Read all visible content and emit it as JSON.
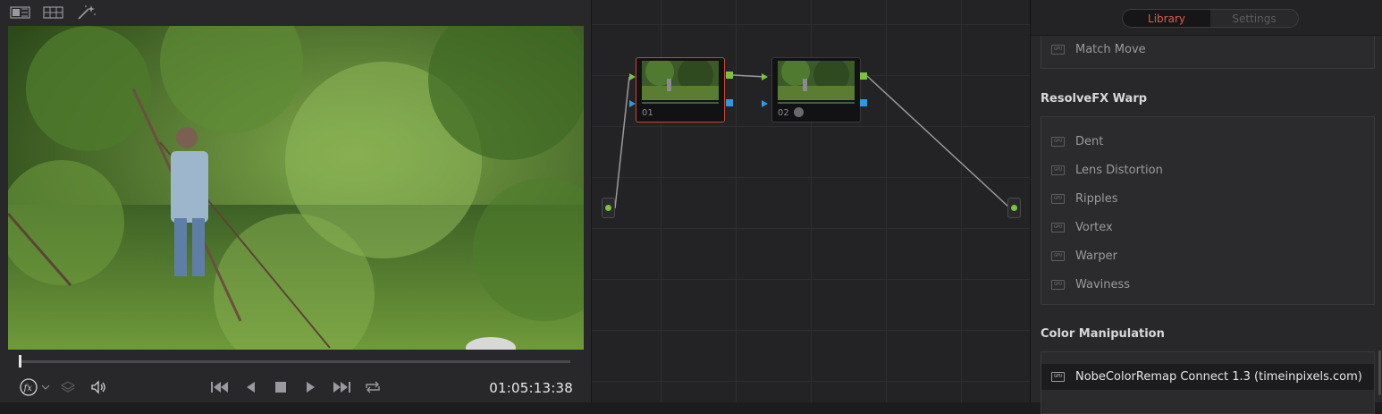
{
  "viewer": {
    "toolbar_icons": [
      "single-viewer-icon",
      "grid-viewer-icon",
      "magic-wand-icon"
    ],
    "timecode": "01:05:13:38",
    "playhead_position": 0.0,
    "transport_icons": [
      "fx-icon",
      "chevron-down-icon",
      "layers-icon",
      "speaker-icon",
      "skip-to-start-icon",
      "play-reverse-icon",
      "stop-icon",
      "play-icon",
      "skip-to-end-icon",
      "loop-icon"
    ]
  },
  "node_graph": {
    "nodes": [
      {
        "label": "01",
        "selected": true
      },
      {
        "label": "02",
        "selected": false
      }
    ]
  },
  "library": {
    "tabs": [
      {
        "label": "Library",
        "active": true
      },
      {
        "label": "Settings",
        "active": false
      }
    ],
    "top_items": [
      {
        "gpu": "GPU",
        "name": "Match Move"
      }
    ],
    "sections": [
      {
        "title": "ResolveFX Warp",
        "items": [
          {
            "gpu": "GPU",
            "name": "Dent"
          },
          {
            "gpu": "GPU",
            "name": "Lens Distortion"
          },
          {
            "gpu": "GPU",
            "name": "Ripples"
          },
          {
            "gpu": "GPU",
            "name": "Vortex"
          },
          {
            "gpu": "GPU",
            "name": "Warper"
          },
          {
            "gpu": "GPU",
            "name": "Waviness"
          }
        ]
      },
      {
        "title": "Color Manipulation",
        "items": [
          {
            "gpu": "GPU",
            "name": "NobeColorRemap Connect 1.3 (timeinpixels.com)"
          }
        ]
      }
    ]
  },
  "colors": {
    "accent_red": "#e05a4a",
    "node_selected_border": "#c6443a",
    "port_green": "#7cc23b",
    "port_blue": "#2d9ae0"
  }
}
